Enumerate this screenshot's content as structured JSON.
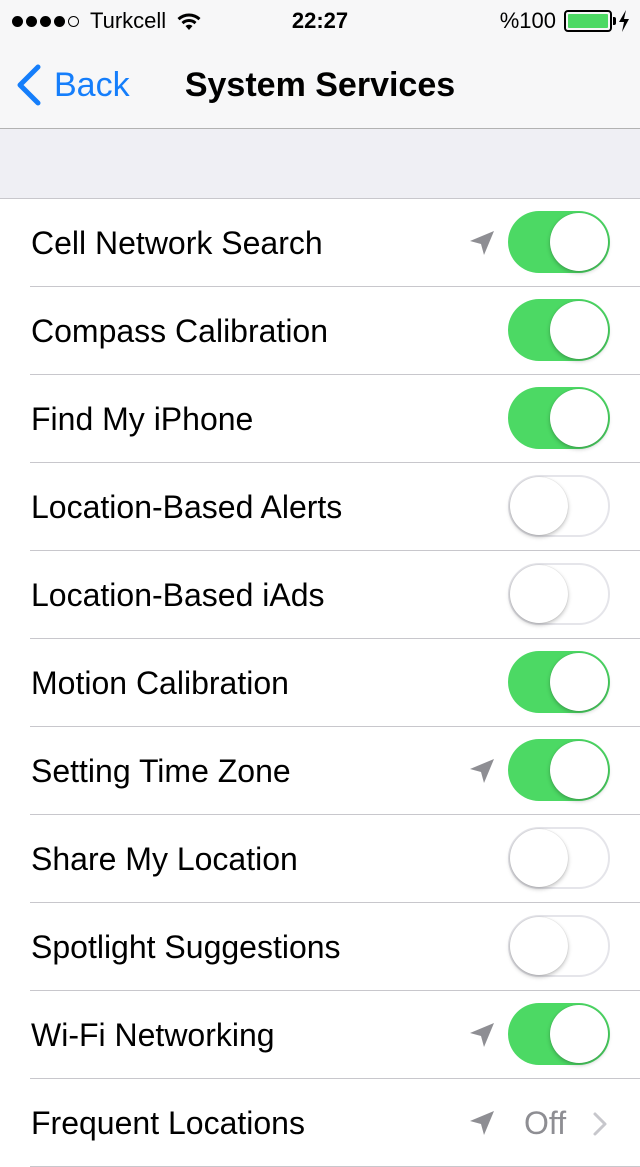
{
  "status": {
    "carrier": "Turkcell",
    "time": "22:27",
    "battery": "%100",
    "signal_bars": 4,
    "signal_total": 5,
    "battery_level": 1.0,
    "battery_color": "#4cd964"
  },
  "nav": {
    "back_label": "Back",
    "title": "System Services",
    "accent": "#157efb"
  },
  "toggle_on_color": "#4cd964",
  "rows": [
    {
      "label": "Cell Network Search",
      "on": true,
      "location_icon": true
    },
    {
      "label": "Compass Calibration",
      "on": true,
      "location_icon": false
    },
    {
      "label": "Find My iPhone",
      "on": true,
      "location_icon": false
    },
    {
      "label": "Location-Based Alerts",
      "on": false,
      "location_icon": false
    },
    {
      "label": "Location-Based iAds",
      "on": false,
      "location_icon": false
    },
    {
      "label": "Motion Calibration",
      "on": true,
      "location_icon": false
    },
    {
      "label": "Setting Time Zone",
      "on": true,
      "location_icon": true
    },
    {
      "label": "Share My Location",
      "on": false,
      "location_icon": false
    },
    {
      "label": "Spotlight Suggestions",
      "on": false,
      "location_icon": false
    },
    {
      "label": "Wi-Fi Networking",
      "on": true,
      "location_icon": true
    }
  ],
  "frequent": {
    "label": "Frequent Locations",
    "value": "Off",
    "location_icon": true,
    "chevron_icon": "chevron-right-icon"
  }
}
